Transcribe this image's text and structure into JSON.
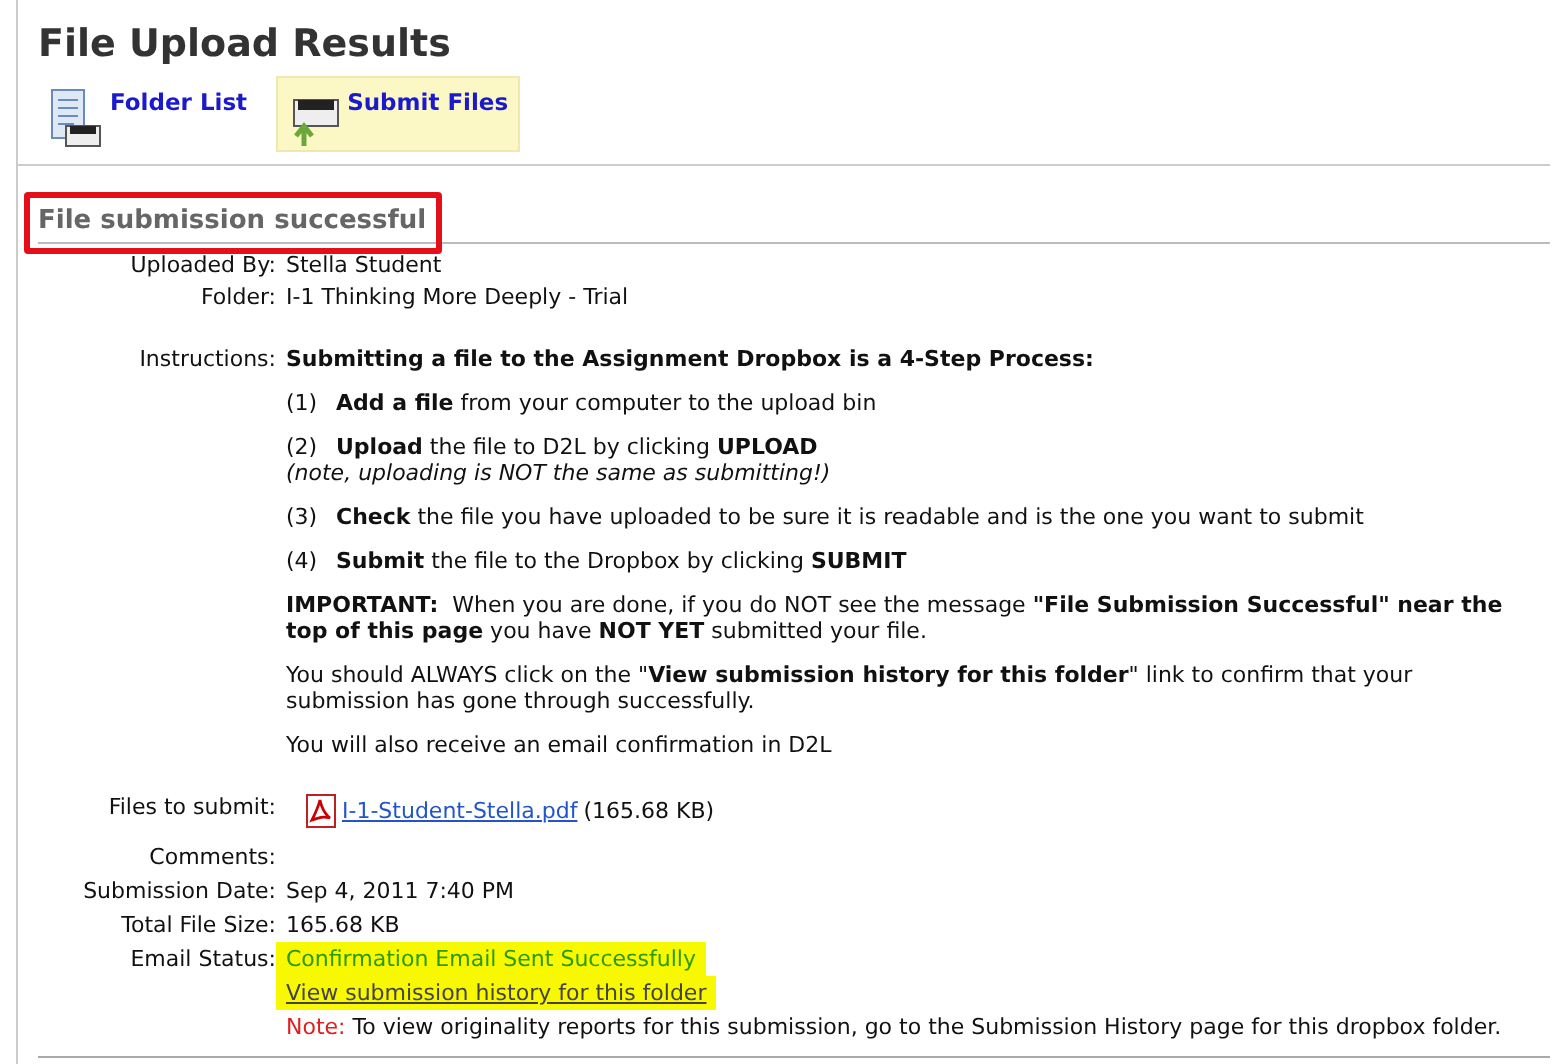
{
  "page_title": "File Upload Results",
  "toolbar": [
    {
      "label": "Folder List",
      "kind": "list",
      "selected": false
    },
    {
      "label": "Submit Files",
      "kind": "submit",
      "selected": true
    }
  ],
  "section": {
    "title": "File submission successful",
    "annotated": true
  },
  "details": [
    {
      "label": "Uploaded By:",
      "value": "Stella Student"
    },
    {
      "label": "Folder:",
      "value": "I-1 Thinking More Deeply - Trial"
    }
  ],
  "instructions": {
    "label": "Instructions:",
    "heading": "Submitting a file to the Assignment Dropbox is a 4-Step Process:",
    "steps": [
      {
        "number": "(1)",
        "text": "**Add a file** from your computer to the upload bin"
      },
      {
        "number": "(2)",
        "text": "**Upload** the file to D2L by clicking **UPLOAD**",
        "note": "(note, uploading is NOT the same as submitting!)"
      },
      {
        "number": "(3)",
        "text": "**Check** the file you have uploaded to be sure it is readable and is the one you want to submit"
      },
      {
        "number": "(4)",
        "text": "**Submit** the file to the Dropbox by clicking **SUBMIT**"
      }
    ],
    "paragraphs": [
      "**IMPORTANT:**  When you are done, if you do NOT see the message **\"File Submission Successful\" near the top of this page** you have **NOT YET** submitted your file.",
      "You should ALWAYS click on the \"**View submission history for this folder**\" link to confirm that your submission has gone through successfully.",
      "You will also receive an email confirmation in D2L"
    ]
  },
  "files": {
    "label": "Files to submit:",
    "file_name": "I-1-Student-Stella.pdf",
    "size": "(165.68 KB)"
  },
  "summary": [
    {
      "label": "Comments:"
    },
    {
      "label": "Submission Date:",
      "value": "Sep 4, 2011 7:40 PM"
    },
    {
      "label": "Total File Size:",
      "value": "165.68 KB"
    }
  ],
  "email_status": {
    "label": "Email Status:",
    "status": "Confirmation Email Sent Successfully",
    "status_highlighted": true,
    "history_link": "View submission history for this folder",
    "link_highlighted": true,
    "note_label": "Note:",
    "note_text": "To view originality reports for this submission, go to the Submission History page for this dropbox folder."
  }
}
